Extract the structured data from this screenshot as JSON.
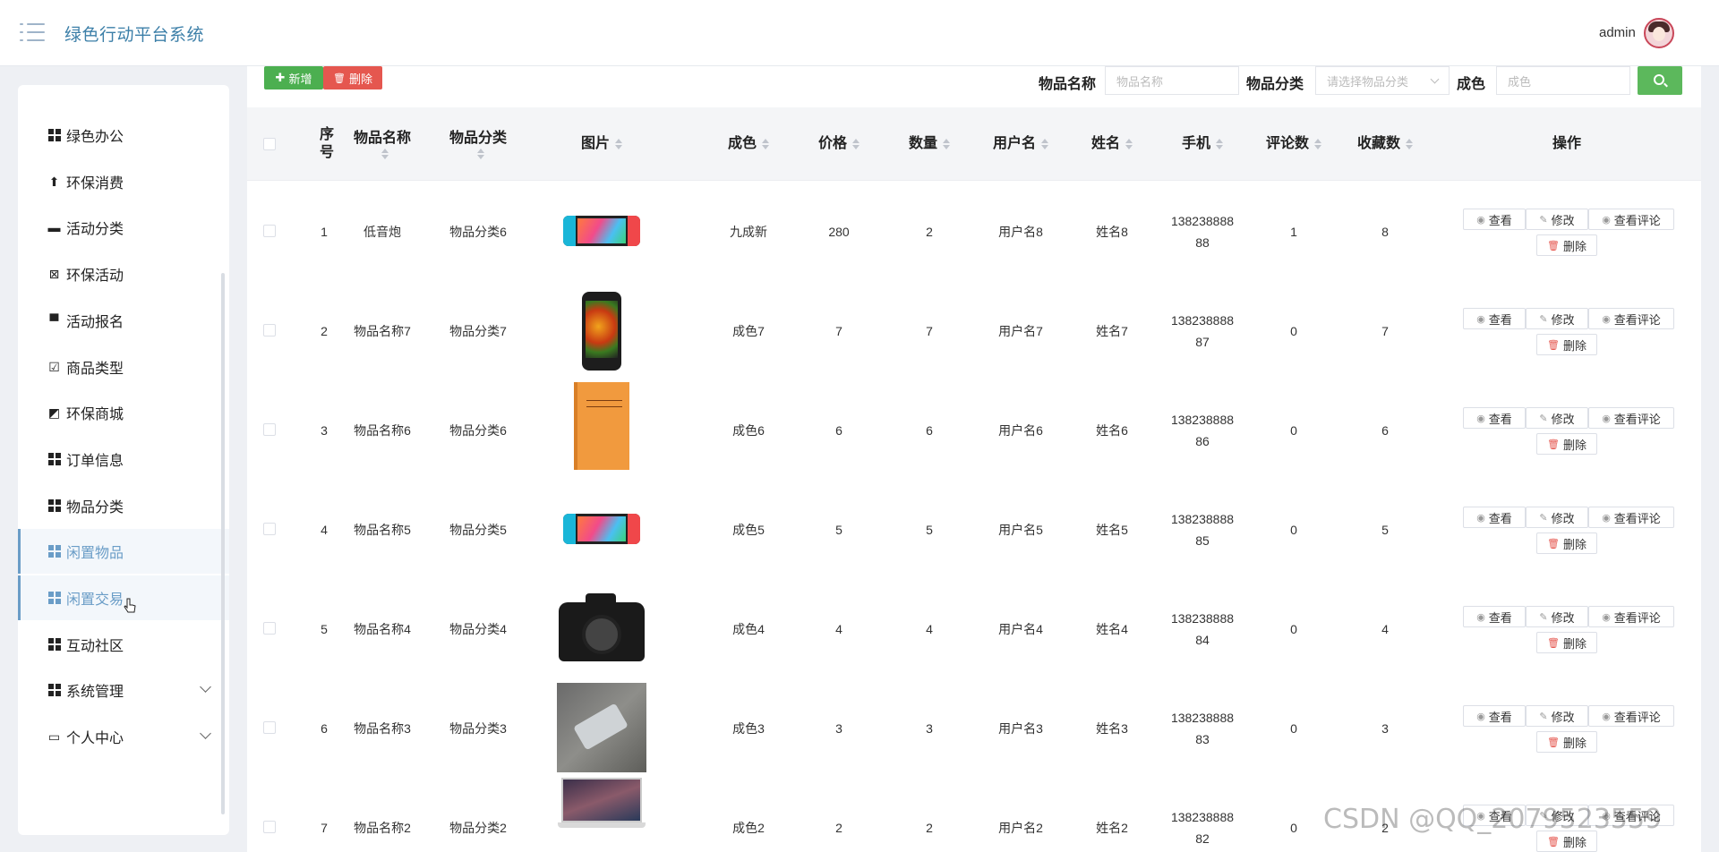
{
  "header": {
    "app_title": "绿色行动平台系统",
    "user_name": "admin",
    "menu_icon": "menu-toggle-icon",
    "avatar_icon": "user-avatar"
  },
  "sidebar": {
    "items": [
      {
        "label": "绿色办公",
        "icon": "grid-icon"
      },
      {
        "label": "环保消费",
        "icon": "user-icon"
      },
      {
        "label": "活动分类",
        "icon": "briefcase-icon"
      },
      {
        "label": "环保活动",
        "icon": "clipboard-x-icon"
      },
      {
        "label": "活动报名",
        "icon": "monitor-icon"
      },
      {
        "label": "商品类型",
        "icon": "clipboard-check-icon"
      },
      {
        "label": "环保商城",
        "icon": "chart-line-icon"
      },
      {
        "label": "订单信息",
        "icon": "grid-icon"
      },
      {
        "label": "物品分类",
        "icon": "grid-icon"
      },
      {
        "label": "闲置物品",
        "icon": "grid-icon",
        "active": true
      },
      {
        "label": "闲置交易",
        "icon": "grid-icon",
        "active": true
      },
      {
        "label": "互动社区",
        "icon": "grid-icon"
      },
      {
        "label": "系统管理",
        "icon": "grid-icon",
        "expandable": true
      },
      {
        "label": "个人中心",
        "icon": "id-card-icon",
        "expandable": true
      }
    ]
  },
  "toolbar": {
    "add_label": "新增",
    "delete_label": "删除",
    "search": {
      "name_label": "物品名称",
      "name_placeholder": "物品名称",
      "category_label": "物品分类",
      "category_placeholder": "请选择物品分类",
      "condition_label": "成色",
      "condition_placeholder": "成色",
      "search_icon": "search-icon"
    }
  },
  "table": {
    "headers": {
      "index": "序号",
      "name": "物品名称",
      "category": "物品分类",
      "image": "图片",
      "condition": "成色",
      "price": "价格",
      "quantity": "数量",
      "username": "用户名",
      "realname": "姓名",
      "phone": "手机",
      "comments": "评论数",
      "favorites": "收藏数",
      "actions": "操作"
    },
    "action_labels": {
      "view": "查看",
      "edit": "修改",
      "view_comments": "查看评论",
      "delete": "删除"
    },
    "rows": [
      {
        "index": "1",
        "name": "低音炮",
        "category": "物品分类6",
        "image": "game-console",
        "condition": "九成新",
        "price": "280",
        "quantity": "2",
        "username": "用户名8",
        "realname": "姓名8",
        "phone_a": "138238888",
        "phone_b": "88",
        "comments": "1",
        "favorites": "8"
      },
      {
        "index": "2",
        "name": "物品名称7",
        "category": "物品分类7",
        "image": "smartphone",
        "condition": "成色7",
        "price": "7",
        "quantity": "7",
        "username": "用户名7",
        "realname": "姓名7",
        "phone_a": "138238888",
        "phone_b": "87",
        "comments": "0",
        "favorites": "7"
      },
      {
        "index": "3",
        "name": "物品名称6",
        "category": "物品分类6",
        "image": "book",
        "condition": "成色6",
        "price": "6",
        "quantity": "6",
        "username": "用户名6",
        "realname": "姓名6",
        "phone_a": "138238888",
        "phone_b": "86",
        "comments": "0",
        "favorites": "6"
      },
      {
        "index": "4",
        "name": "物品名称5",
        "category": "物品分类5",
        "image": "game-console",
        "condition": "成色5",
        "price": "5",
        "quantity": "5",
        "username": "用户名5",
        "realname": "姓名5",
        "phone_a": "138238888",
        "phone_b": "85",
        "comments": "0",
        "favorites": "5"
      },
      {
        "index": "5",
        "name": "物品名称4",
        "category": "物品分类4",
        "image": "camera",
        "condition": "成色4",
        "price": "4",
        "quantity": "4",
        "username": "用户名4",
        "realname": "姓名4",
        "phone_a": "138238888",
        "phone_b": "84",
        "comments": "0",
        "favorites": "4"
      },
      {
        "index": "6",
        "name": "物品名称3",
        "category": "物品分类3",
        "image": "photo",
        "condition": "成色3",
        "price": "3",
        "quantity": "3",
        "username": "用户名3",
        "realname": "姓名3",
        "phone_a": "138238888",
        "phone_b": "83",
        "comments": "0",
        "favorites": "3"
      },
      {
        "index": "7",
        "name": "物品名称2",
        "category": "物品分类2",
        "image": "laptop",
        "condition": "成色2",
        "price": "2",
        "quantity": "2",
        "username": "用户名2",
        "realname": "姓名2",
        "phone_a": "138238888",
        "phone_b": "82",
        "comments": "0",
        "favorites": "2"
      }
    ]
  },
  "watermark": "CSDN @QQ_2079523559",
  "colors": {
    "accent": "#6a9dc7",
    "add": "#4caf50",
    "danger": "#e5574f",
    "search": "#5cb85c"
  }
}
